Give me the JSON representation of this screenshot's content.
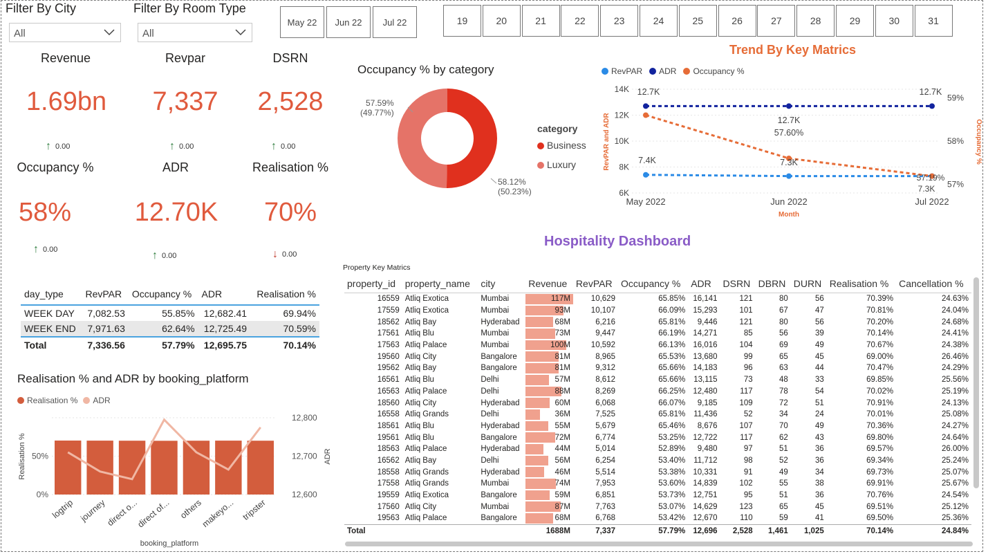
{
  "filters": {
    "city_title": "Filter By City",
    "city_value": "All",
    "room_title": "Filter By Room Type",
    "room_value": "All"
  },
  "months": [
    "May 22",
    "Jun 22",
    "Jul 22"
  ],
  "days": [
    "19",
    "20",
    "21",
    "22",
    "23",
    "24",
    "25",
    "26",
    "27",
    "28",
    "29",
    "30",
    "31"
  ],
  "kpis": [
    {
      "title": "Revenue",
      "value": "1.69bn",
      "trend": "0.00",
      "dir": "up"
    },
    {
      "title": "Revpar",
      "value": "7,337",
      "trend": "0.00",
      "dir": "up"
    },
    {
      "title": "DSRN",
      "value": "2,528",
      "trend": "0.00",
      "dir": "up"
    },
    {
      "title": "Occupancy %",
      "value": "58%",
      "trend": "0.00",
      "dir": "up"
    },
    {
      "title": "ADR",
      "value": "12.70K",
      "trend": "0.00",
      "dir": "up"
    },
    {
      "title": "Realisation %",
      "value": "70%",
      "trend": "0.00",
      "dir": "down"
    }
  ],
  "colors": {
    "accent": "#e05a3d",
    "business": "#e0301e",
    "luxury": "#e57368",
    "revpar": "#2b8be6",
    "adr": "#12239e",
    "occupancy": "#e66c37",
    "bar": "#d35d3d",
    "title_purple": "#8a5cc7"
  },
  "daytype_table": {
    "headers": [
      "day_type",
      "RevPAR",
      "Occupancy %",
      "ADR",
      "Realisation %"
    ],
    "rows": [
      [
        "WEEK DAY",
        "7,082.53",
        "55.85%",
        "12,682.41",
        "69.94%"
      ],
      [
        "WEEK END",
        "7,971.63",
        "62.64%",
        "12,725.49",
        "70.59%"
      ]
    ],
    "total": [
      "Total",
      "7,336.56",
      "57.79%",
      "12,695.75",
      "70.14%"
    ]
  },
  "donut": {
    "title": "Occupancy % by category",
    "legend_title": "category",
    "labels": [
      {
        "name": "Business",
        "label": "58.12%",
        "sub": "(50.23%)"
      },
      {
        "name": "Luxury",
        "label": "57.59%",
        "sub": "(49.77%)"
      }
    ]
  },
  "trend": {
    "title": "Trend By Key Matrics",
    "legend": [
      "RevPAR",
      "ADR",
      "Occupancy %"
    ],
    "yleft_label": "RevPAR and ADR",
    "yright_label": "Occupancy %",
    "xlabel": "Month",
    "yleft_ticks": [
      "14K",
      "12K",
      "10K",
      "8K",
      "6K"
    ],
    "yright_ticks": [
      "59%",
      "58%",
      "57%"
    ],
    "data_labels": {
      "adr": [
        "12.7K",
        "12.7K",
        "12.7K"
      ],
      "occ": [
        "57.60%",
        "57.19%"
      ],
      "revpar": [
        "7.4K",
        "7.3K",
        "7.3K"
      ]
    }
  },
  "dashboard_title": "Hospitality Dashboard",
  "platform_chart": {
    "title": "Realisation % and ADR by booking_platform",
    "legend": [
      "Realisation %",
      "ADR"
    ],
    "yleft_label": "Realisation %",
    "yright_label": "ADR",
    "xlabel": "booking_platform",
    "yleft_ticks": [
      "50%",
      "0%"
    ],
    "yright_ticks": [
      "12,800",
      "12,700",
      "12,600"
    ],
    "categories": [
      "logtrip",
      "journey",
      "direct o...",
      "direct of...",
      "others",
      "makeyo...",
      "tripster"
    ]
  },
  "property_table": {
    "caption": "Property Key Matrics",
    "headers": [
      "property_id",
      "property_name",
      "city",
      "Revenue",
      "RevPAR",
      "Occupancy %",
      "ADR",
      "DSRN",
      "DBRN",
      "DURN",
      "Realisation %",
      "Cancellation %"
    ],
    "rows": [
      [
        "16559",
        "Atliq Exotica",
        "Mumbai",
        "117M",
        "10,629",
        "65.85%",
        "16,141",
        "121",
        "80",
        "56",
        "70.39%",
        "24.63%"
      ],
      [
        "17559",
        "Atliq Exotica",
        "Mumbai",
        "93M",
        "10,107",
        "66.09%",
        "15,293",
        "101",
        "67",
        "47",
        "70.81%",
        "24.04%"
      ],
      [
        "18562",
        "Atliq Bay",
        "Hyderabad",
        "68M",
        "6,216",
        "65.81%",
        "9,446",
        "121",
        "80",
        "56",
        "70.20%",
        "24.68%"
      ],
      [
        "17561",
        "Atliq Blu",
        "Mumbai",
        "73M",
        "9,447",
        "66.19%",
        "14,271",
        "85",
        "56",
        "39",
        "70.14%",
        "24.41%"
      ],
      [
        "17563",
        "Atliq Palace",
        "Mumbai",
        "100M",
        "10,592",
        "66.13%",
        "16,016",
        "104",
        "69",
        "49",
        "70.67%",
        "24.38%"
      ],
      [
        "19560",
        "Atliq City",
        "Bangalore",
        "81M",
        "8,965",
        "65.53%",
        "13,680",
        "99",
        "65",
        "45",
        "69.00%",
        "26.46%"
      ],
      [
        "19562",
        "Atliq Bay",
        "Bangalore",
        "81M",
        "9,312",
        "65.66%",
        "14,183",
        "96",
        "63",
        "44",
        "70.47%",
        "24.29%"
      ],
      [
        "16561",
        "Atliq Blu",
        "Delhi",
        "57M",
        "8,612",
        "65.66%",
        "13,115",
        "73",
        "48",
        "33",
        "69.85%",
        "25.56%"
      ],
      [
        "16563",
        "Atliq Palace",
        "Delhi",
        "88M",
        "8,269",
        "66.25%",
        "12,480",
        "117",
        "78",
        "54",
        "70.02%",
        "25.19%"
      ],
      [
        "18560",
        "Atliq City",
        "Hyderabad",
        "60M",
        "6,068",
        "66.07%",
        "9,185",
        "109",
        "72",
        "51",
        "70.91%",
        "24.13%"
      ],
      [
        "16558",
        "Atliq Grands",
        "Delhi",
        "36M",
        "7,525",
        "65.81%",
        "11,436",
        "52",
        "34",
        "24",
        "70.01%",
        "25.08%"
      ],
      [
        "18561",
        "Atliq Blu",
        "Hyderabad",
        "55M",
        "5,679",
        "65.46%",
        "8,676",
        "107",
        "70",
        "49",
        "70.36%",
        "24.27%"
      ],
      [
        "19561",
        "Atliq Blu",
        "Bangalore",
        "72M",
        "6,774",
        "53.25%",
        "12,722",
        "117",
        "62",
        "43",
        "69.80%",
        "24.64%"
      ],
      [
        "18563",
        "Atliq Palace",
        "Hyderabad",
        "44M",
        "5,014",
        "52.89%",
        "9,480",
        "97",
        "51",
        "36",
        "69.57%",
        "26.00%"
      ],
      [
        "16562",
        "Atliq Bay",
        "Delhi",
        "56M",
        "6,254",
        "53.40%",
        "11,712",
        "98",
        "52",
        "36",
        "69.34%",
        "25.24%"
      ],
      [
        "18558",
        "Atliq Grands",
        "Hyderabad",
        "46M",
        "5,514",
        "53.38%",
        "10,331",
        "91",
        "49",
        "34",
        "69.73%",
        "25.07%"
      ],
      [
        "17558",
        "Atliq Grands",
        "Mumbai",
        "74M",
        "7,953",
        "53.60%",
        "14,839",
        "102",
        "55",
        "38",
        "69.91%",
        "25.67%"
      ],
      [
        "19559",
        "Atliq Exotica",
        "Bangalore",
        "59M",
        "6,851",
        "53.73%",
        "12,751",
        "95",
        "51",
        "36",
        "70.76%",
        "24.54%"
      ],
      [
        "17560",
        "Atliq City",
        "Mumbai",
        "87M",
        "7,763",
        "53.07%",
        "14,629",
        "123",
        "65",
        "45",
        "69.51%",
        "25.12%"
      ],
      [
        "19563",
        "Atliq Palace",
        "Bangalore",
        "68M",
        "6,768",
        "53.42%",
        "12,670",
        "110",
        "59",
        "41",
        "69.50%",
        "25.36%"
      ]
    ],
    "revenue_values": [
      117,
      93,
      68,
      73,
      100,
      81,
      81,
      57,
      88,
      60,
      36,
      55,
      72,
      44,
      56,
      46,
      74,
      59,
      87,
      68
    ],
    "total": [
      "Total",
      "",
      "",
      "1688M",
      "7,337",
      "57.79%",
      "12,696",
      "2,528",
      "1,461",
      "1,025",
      "70.14%",
      "24.84%"
    ]
  },
  "chart_data": [
    {
      "type": "pie",
      "title": "Occupancy % by category",
      "categories": [
        "Business",
        "Luxury"
      ],
      "values": [
        58.12,
        57.59
      ],
      "share": [
        50.23,
        49.77
      ]
    },
    {
      "type": "line",
      "title": "Trend By Key Matrics",
      "x": [
        "May 2022",
        "Jun 2022",
        "Jul 2022"
      ],
      "xlabel": "Month",
      "ylabel": "RevPAR and ADR",
      "ylim": [
        6000,
        14000
      ],
      "y2label": "Occupancy %",
      "y2lim": [
        56.8,
        59.2
      ],
      "series": [
        {
          "name": "RevPAR",
          "axis": "left",
          "values": [
            7400,
            7300,
            7300
          ]
        },
        {
          "name": "ADR",
          "axis": "left",
          "values": [
            12700,
            12700,
            12700
          ]
        },
        {
          "name": "Occupancy %",
          "axis": "right",
          "values": [
            58.6,
            57.6,
            57.19
          ]
        }
      ]
    },
    {
      "type": "bar",
      "title": "Realisation % and ADR by booking_platform",
      "categories": [
        "logtrip",
        "journey",
        "direct o...",
        "direct of...",
        "others",
        "makeyo...",
        "tripster"
      ],
      "xlabel": "booking_platform",
      "ylabel": "Realisation %",
      "ylim": [
        0,
        100
      ],
      "y2label": "ADR",
      "y2lim": [
        12600,
        12800
      ],
      "series": [
        {
          "name": "Realisation %",
          "type": "bar",
          "axis": "left",
          "values": [
            70.3,
            70.2,
            70.1,
            70.0,
            70.1,
            70.2,
            70.1
          ]
        },
        {
          "name": "ADR",
          "type": "line",
          "axis": "right",
          "values": [
            12710,
            12660,
            12640,
            12795,
            12710,
            12665,
            12775
          ]
        }
      ]
    }
  ]
}
